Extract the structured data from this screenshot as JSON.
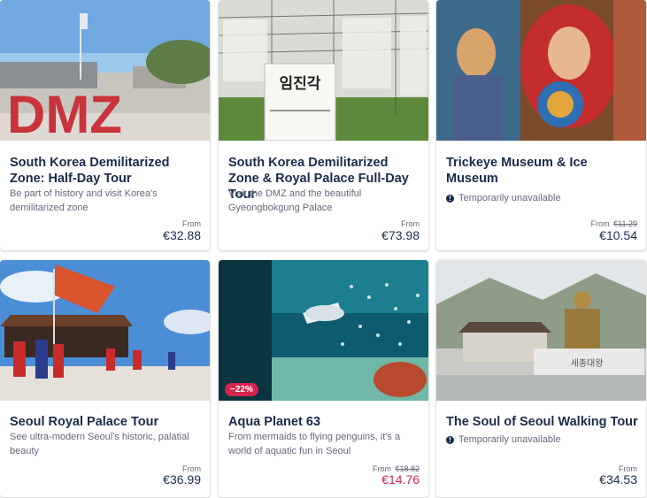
{
  "cards": [
    {
      "title": "South Korea Demilitarized Zone: Half-Day Tour",
      "description": "Be part of history and visit Korea's demilitarized zone",
      "from_label": "From",
      "price": "€32.88",
      "image_text": "DMZ"
    },
    {
      "title": "South Korea Demilitarized Zone & Royal Palace Full-Day Tour",
      "description": "Visit the DMZ and the beautiful Gyeongbokgung Palace",
      "from_label": "From",
      "price": "€73.98",
      "image_text": "임진각"
    },
    {
      "title": "Trickeye Museum & Ice Museum",
      "status": "Temporarily unavailable",
      "from_label": "From",
      "old_price": "€11.29",
      "price": "€10.54"
    },
    {
      "title": "Seoul Royal Palace Tour",
      "description": "See ultra-modern Seoul's historic, palatial beauty",
      "from_label": "From",
      "price": "€36.99"
    },
    {
      "title": "Aqua Planet 63",
      "description": "From mermaids to flying penguins, it's a world of aquatic fun in Seoul",
      "badge": "−22%",
      "from_label": "From",
      "old_price": "€18.82",
      "price": "€14.76"
    },
    {
      "title": "The Soul of Seoul Walking Tour",
      "status": "Temporarily unavailable",
      "from_label": "From",
      "price": "€34.53",
      "image_text": "세종대왕"
    }
  ],
  "icons": {
    "status": "info-circle-icon"
  },
  "colors": {
    "title": "#1a2b49",
    "muted": "#63687a",
    "sale": "#d6244d"
  }
}
